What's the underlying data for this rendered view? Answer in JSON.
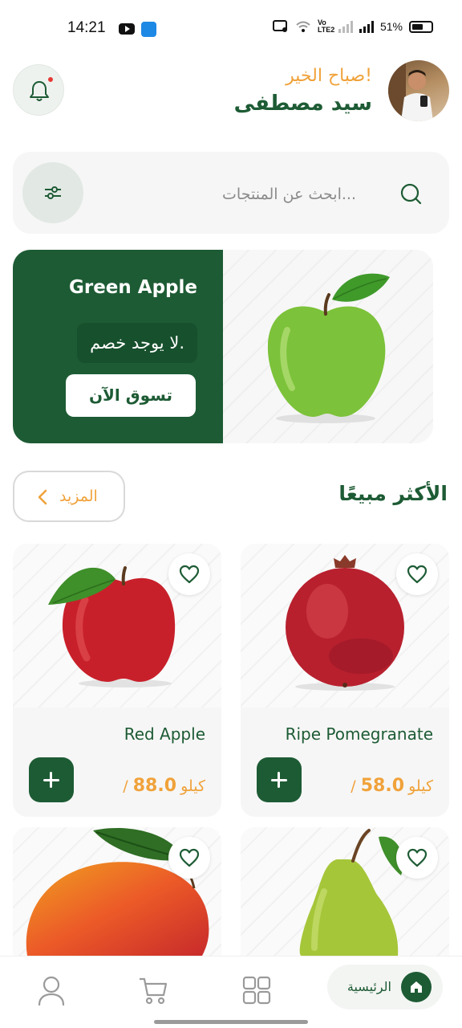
{
  "status_bar": {
    "time": "14:21",
    "battery": "51%",
    "network_badge": "Vo\nLTE2"
  },
  "header": {
    "greeting": "صباح الخير!",
    "user_name": "سيد مصطفى"
  },
  "search": {
    "placeholder": "ابحث عن المنتجات..."
  },
  "banner": {
    "title": "Green Apple",
    "discount_text": "لا يوجد خصم.",
    "cta_label": "تسوق الآن"
  },
  "best_sellers": {
    "title": "الأكثر مبيعًا",
    "more_label": "المزيد",
    "products": [
      {
        "name": "Ripe Pomegranate",
        "price": "58.0",
        "unit": "/ كيلو"
      },
      {
        "name": "Red Apple",
        "price": "88.0",
        "unit": "/ كيلو"
      },
      {
        "name": "Pear",
        "price": "",
        "unit": ""
      },
      {
        "name": "Mango",
        "price": "",
        "unit": ""
      }
    ]
  },
  "bottom_nav": {
    "home_label": "الرئيسية"
  },
  "colors": {
    "brand_green": "#1d5b34",
    "accent_orange": "#f0a23a",
    "notification_dot": "#e53935"
  }
}
